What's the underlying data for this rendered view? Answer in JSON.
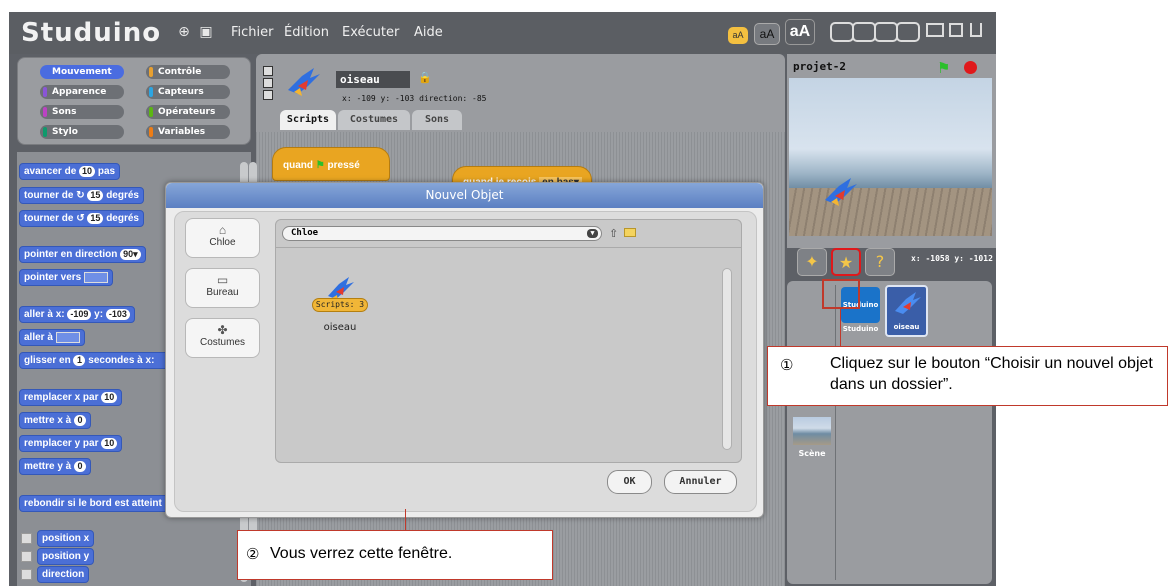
{
  "app": {
    "logo": "Studuino",
    "menu": [
      "Fichier",
      "Édition",
      "Exécuter",
      "Aide"
    ],
    "font_buttons": [
      "aA",
      "aA",
      "aA"
    ]
  },
  "categories": [
    {
      "label": "Mouvement",
      "color": "#4a6ce0",
      "active": true
    },
    {
      "label": "Contrôle",
      "color": "#e8a030"
    },
    {
      "label": "Apparence",
      "color": "#8a55d7"
    },
    {
      "label": "Capteurs",
      "color": "#2ca5e2"
    },
    {
      "label": "Sons",
      "color": "#bb42c3"
    },
    {
      "label": "Opérateurs",
      "color": "#5cb712"
    },
    {
      "label": "Stylo",
      "color": "#0e9a6c"
    },
    {
      "label": "Variables",
      "color": "#ee7d16"
    }
  ],
  "palette": {
    "move_a": "avancer de",
    "move_b": "pas",
    "move_val": "10",
    "turn_right_a": "tourner de",
    "turn_right_b": "degrés",
    "turn_right_val": "15",
    "turn_left_a": "tourner de",
    "turn_left_b": "degrés",
    "turn_left_val": "15",
    "point_dir": "pointer en direction",
    "point_dir_val": "90▾",
    "point_to": "pointer vers",
    "goto_xy_a": "aller à x:",
    "goto_xy_x": "-109",
    "goto_xy_b": "y:",
    "goto_xy_y": "-103",
    "goto": "aller à",
    "glide_a": "glisser en",
    "glide_val": "1",
    "glide_b": "secondes à x:",
    "setx": "remplacer x par",
    "setx_val": "10",
    "x0": "mettre x à",
    "x0_val": "0",
    "sety": "remplacer y par",
    "sety_val": "10",
    "y0": "mettre y à",
    "y0_val": "0",
    "bounce": "rebondir si le bord est atteint",
    "pos_x": "position x",
    "pos_y": "position y",
    "direction": "direction"
  },
  "sprite": {
    "name": "oiseau",
    "coords": "x: -109  y: -103  direction: -85",
    "tabs": [
      "Scripts",
      "Costumes",
      "Sons"
    ]
  },
  "scripts": {
    "hat1": "quand",
    "hat1_b": "pressé",
    "hat2": "quand je reçois",
    "hat2_dd": "en bas▾"
  },
  "stage": {
    "title": "projet-2",
    "mouse_coords": "x: -1058  y: -1012"
  },
  "sprites_list": [
    {
      "label": "Studuino",
      "thumb_text": "Studuino"
    },
    {
      "label": "oiseau"
    }
  ],
  "scene_label": "Scène",
  "dialog": {
    "title": "Nouvel Objet",
    "locations": [
      "Chloe",
      "Bureau",
      "Costumes"
    ],
    "path": "Chloe",
    "file_name": "oiseau",
    "file_badge": "Scripts: 3",
    "ok": "OK",
    "cancel": "Annuler"
  },
  "callouts": {
    "step1_num": "①",
    "step1": "Cliquez sur le bouton “Choisir un nouvel objet dans un dossier”.",
    "step2_num": "②",
    "step2": "Vous verrez cette fenêtre."
  },
  "colors": {
    "motion": "#4b6fd6",
    "callout_border": "#c0392b",
    "green_flag": "#2bbf2b",
    "stop": "#e0181b"
  }
}
